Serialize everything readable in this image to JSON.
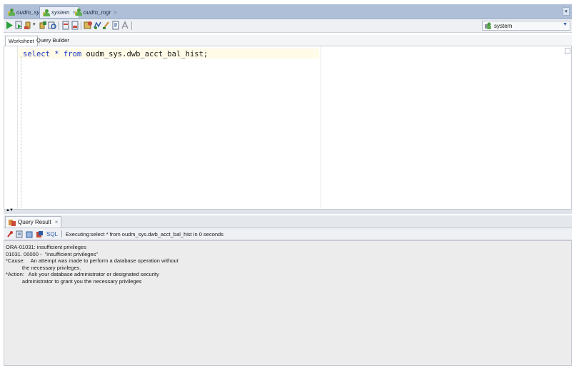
{
  "tabs": [
    {
      "label": "oudm_sys",
      "active": false
    },
    {
      "label": "system",
      "active": true
    },
    {
      "label": "oudm_mgr",
      "active": false
    }
  ],
  "toolbar": {
    "connection": "system",
    "icons": [
      "run-statement-icon",
      "run-script-icon",
      "commit-icon",
      "rollback-icon",
      "explain-plan-icon",
      "autotrace-icon",
      "sql-tuning-icon",
      "clear-icon",
      "history-icon",
      "format-icon",
      "find-icon"
    ]
  },
  "subtabs": {
    "worksheet": "Worksheet",
    "query_builder": "Query Builder"
  },
  "editor": {
    "keyword_select": "select",
    "star": "*",
    "keyword_from": "from",
    "table": "oudm_sys.dwb_acct_bal_hist;"
  },
  "result": {
    "tab_label": "Query Result",
    "sql_label": "SQL",
    "status": "Executing:select * from oudm_sys.dwb_acct_bal_hist in 0 seconds",
    "lines": [
      "ORA-01031: insufficient privileges",
      "01031. 00000 -  \"insufficient privileges\"",
      "*Cause:    An attempt was made to perform a database operation without",
      "           the necessary privileges.",
      "*Action:   Ask your database administrator or designated security",
      "           administrator to grant you the necessary privileges"
    ]
  },
  "colors": {
    "keyword": "#1e36c8",
    "tabbar": "#aebfd7",
    "current_line": "#fffbe6"
  }
}
